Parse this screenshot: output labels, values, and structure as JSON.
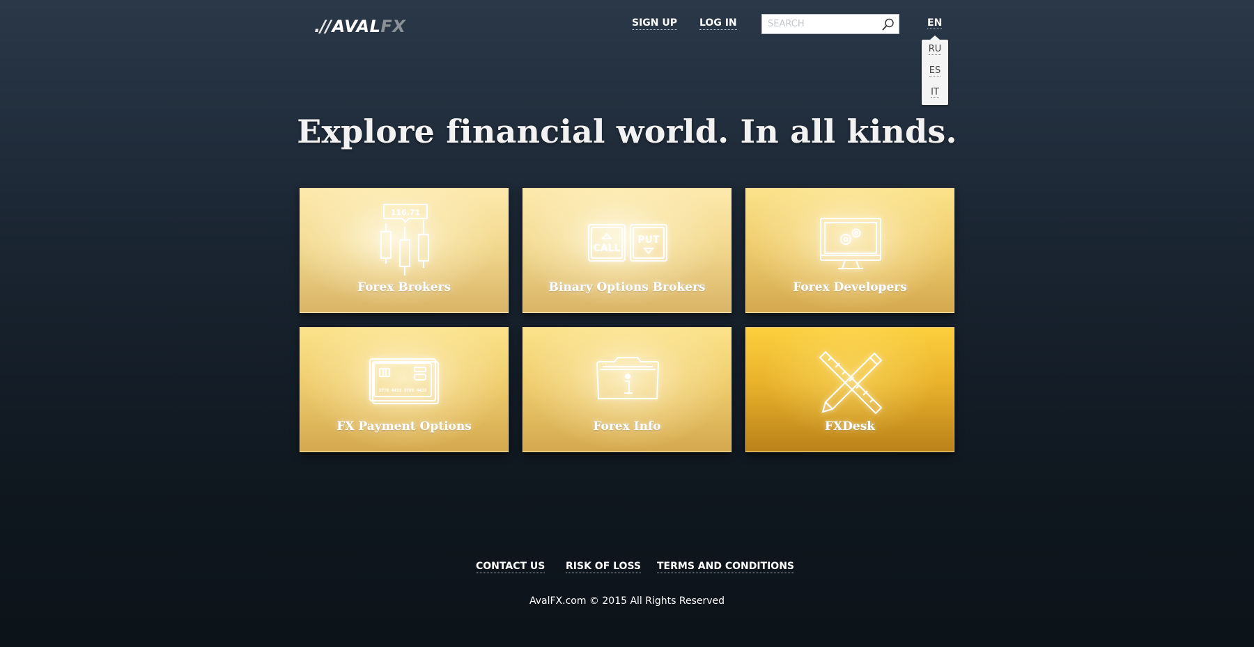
{
  "header": {
    "logo": {
      "slashes": ".//",
      "main": "AVAL",
      "accent": "FX"
    },
    "signup_label": "SIGN UP",
    "login_label": "LOG IN",
    "search": {
      "placeholder": "SEARCH",
      "value": ""
    },
    "language": {
      "current": "EN",
      "options": [
        "RU",
        "ES",
        "IT"
      ]
    }
  },
  "hero": {
    "headline": "Explore financial world. In all kinds."
  },
  "tiles": [
    {
      "label": "Forex Brokers",
      "icon": "candlestick-chart-icon",
      "price_tag": "116.71"
    },
    {
      "label": "Binary Options Brokers",
      "icon": "call-put-icon",
      "call": "CALL",
      "put": "PUT"
    },
    {
      "label": "Forex Developers",
      "icon": "monitor-gears-icon"
    },
    {
      "label": "FX Payment Options",
      "icon": "credit-card-icon",
      "card_number": "3778 4433 3780 4433"
    },
    {
      "label": "Forex Info",
      "icon": "info-folder-icon"
    },
    {
      "label": "FXDesk",
      "icon": "pencil-ruler-icon"
    }
  ],
  "footer": {
    "links": [
      "CONTACT US",
      "RISK OF LOSS",
      "TERMS AND CONDITIONS"
    ],
    "copyright": "AvalFX.com © 2015 All Rights Reserved"
  },
  "colors": {
    "background_top": "#2a3848",
    "background_bottom": "#0c1319",
    "tile_light": "#fde9ad",
    "tile_gold": "#fccf3e"
  }
}
